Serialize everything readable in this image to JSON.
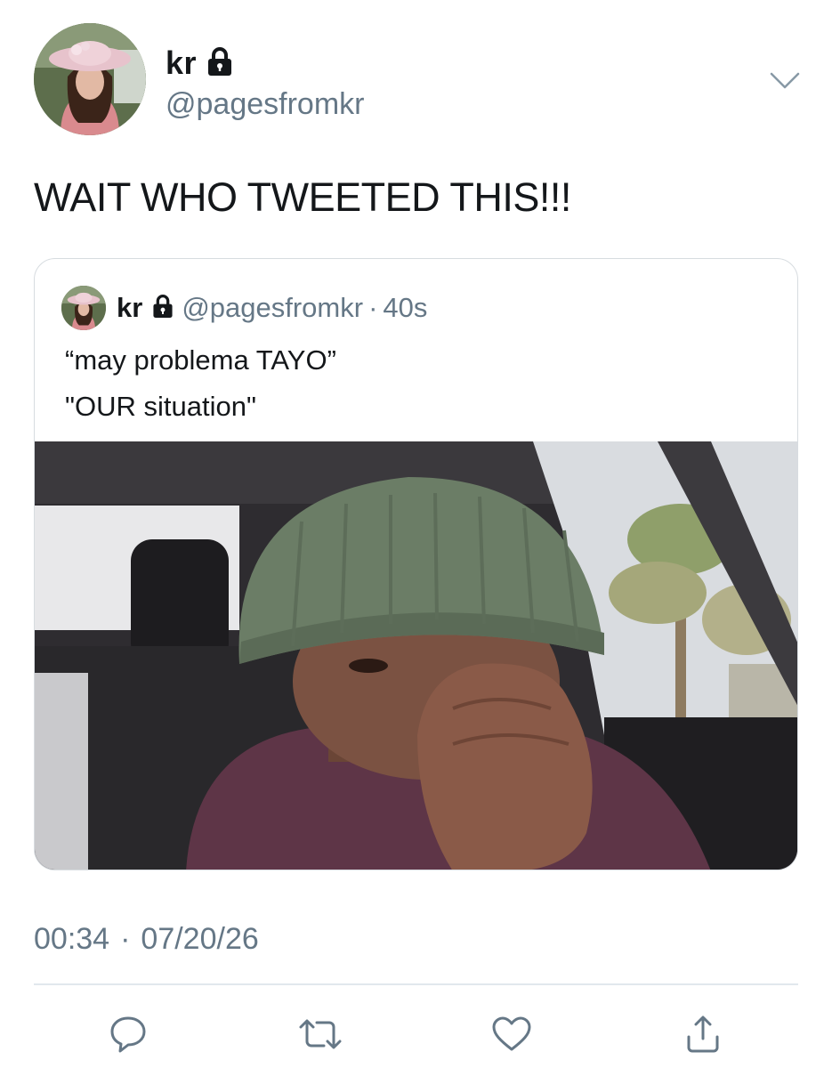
{
  "author": {
    "display_name": "kr",
    "handle": "@pagesfromkr",
    "protected_icon": "lock-icon",
    "avatar_icon": "profile-photo"
  },
  "tweet": {
    "text": "WAIT WHO TWEETED THIS!!!",
    "timestamp_time": "00:34",
    "timestamp_separator": "·",
    "timestamp_date": "07/20/26"
  },
  "quoted_tweet": {
    "display_name": "kr",
    "handle": "@pagesfromkr",
    "separator": "·",
    "age": "40s",
    "lines": [
      "“may problema TAYO”",
      "\"OUR situation\""
    ],
    "media_icon": "meme-photo"
  },
  "actions": {
    "reply_icon": "reply-icon",
    "retweet_icon": "retweet-icon",
    "like_icon": "heart-icon",
    "share_icon": "share-icon"
  },
  "colors": {
    "text": "#14171a",
    "secondary": "#657786",
    "border": "#d7dce0",
    "icon": "#657786"
  }
}
